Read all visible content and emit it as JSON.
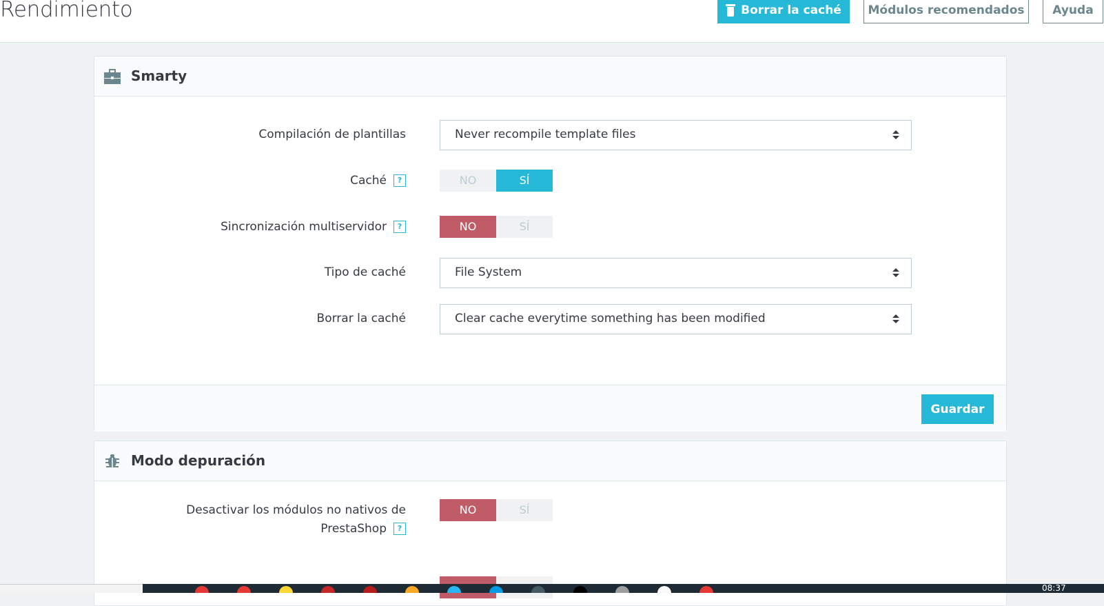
{
  "header": {
    "title": "Rendimiento",
    "clear_cache": "Borrar la caché",
    "recommended": "Módulos recomendados",
    "help": "Ayuda"
  },
  "smarty": {
    "title": "Smarty",
    "template_compilation": {
      "label": "Compilación de plantillas",
      "value": "Never recompile template files"
    },
    "cache": {
      "label": "Caché",
      "help": "?",
      "no": "NO",
      "yes": "SÍ",
      "selected": "SÍ"
    },
    "multi_front": {
      "label": "Sincronización multiservidor",
      "help": "?",
      "no": "NO",
      "yes": "SÍ",
      "selected": "NO"
    },
    "cache_type": {
      "label": "Tipo de caché",
      "value": "File System"
    },
    "clear_cache": {
      "label": "Borrar la caché",
      "value": "Clear cache everytime something has been modified"
    },
    "save": "Guardar"
  },
  "debug": {
    "title": "Modo depuración",
    "disable_non_native": {
      "label_line1": "Desactivar los módulos no nativos de",
      "label_line2": "PrestaShop",
      "help": "?",
      "no": "NO",
      "yes": "SÍ",
      "selected": "NO"
    }
  },
  "taskbar": {
    "clock": "08:37"
  },
  "colors": {
    "accent": "#25b9d7",
    "danger": "#c05c67",
    "background": "#eff1f2"
  },
  "icons": [
    "trash-icon",
    "briefcase-icon",
    "bug-icon",
    "select-arrows-icon",
    "help-icon"
  ]
}
